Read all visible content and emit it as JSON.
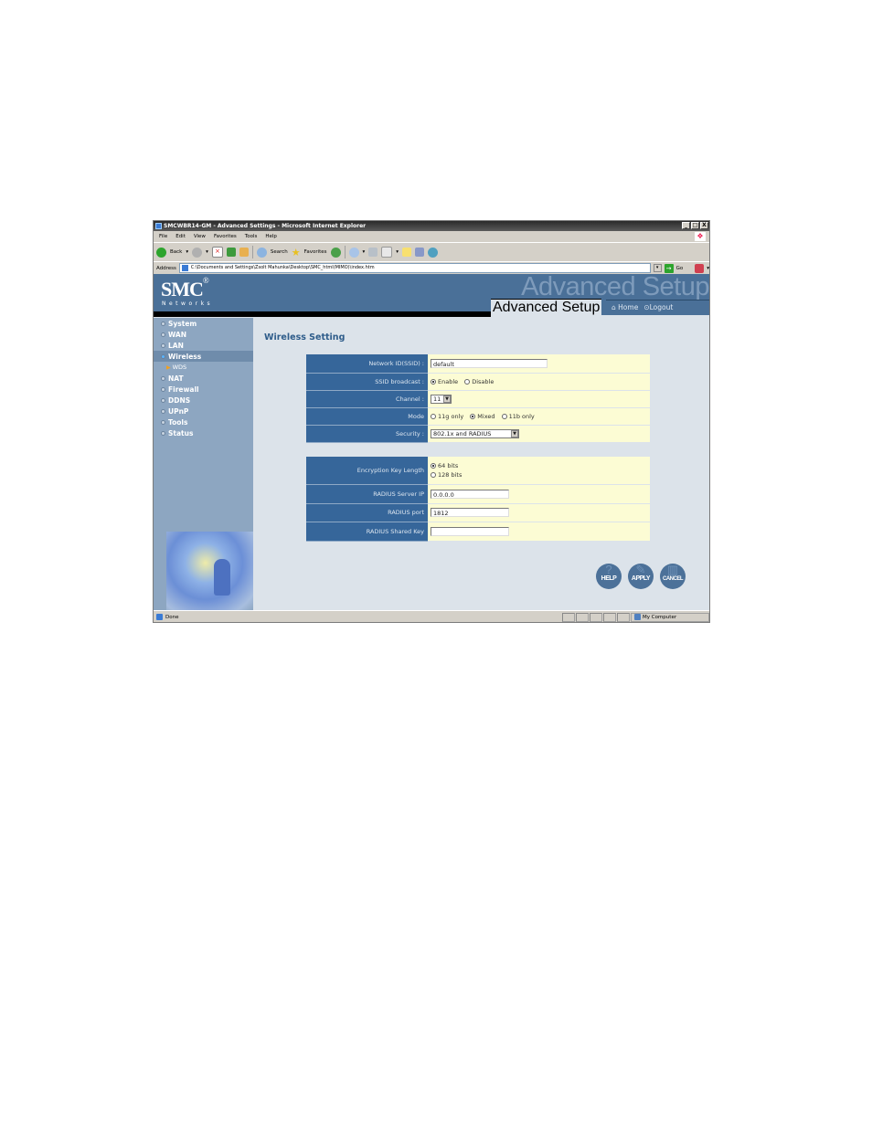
{
  "window": {
    "title": "SMCWBR14-GM - Advanced Settings - Microsoft Internet Explorer",
    "controls": [
      "_",
      "□",
      "X"
    ]
  },
  "menu": [
    "File",
    "Edit",
    "View",
    "Favorites",
    "Tools",
    "Help"
  ],
  "toolbar": {
    "back_label": "Back",
    "search_label": "Search",
    "favorites_label": "Favorites"
  },
  "address": {
    "label": "Address",
    "value": "C:\\Documents and Settings\\Zsolt Mahunka\\Desktop\\SMC_html(MIMO)\\index.htm",
    "go_label": "Go"
  },
  "header": {
    "logo": "SMC",
    "logo_mark": "®",
    "networks": "Networks",
    "banner_watermark": "Advanced Setup",
    "banner_title": "Advanced Setup",
    "home_label": "Home",
    "logout_label": "Logout"
  },
  "sidebar": {
    "items": [
      {
        "label": "System",
        "active": false
      },
      {
        "label": "WAN",
        "active": false
      },
      {
        "label": "LAN",
        "active": false
      },
      {
        "label": "Wireless",
        "active": true
      },
      {
        "label": "NAT",
        "active": false
      },
      {
        "label": "Firewall",
        "active": false
      },
      {
        "label": "DDNS",
        "active": false
      },
      {
        "label": "UPnP",
        "active": false
      },
      {
        "label": "Tools",
        "active": false
      },
      {
        "label": "Status",
        "active": false
      }
    ],
    "subitem": "WDS"
  },
  "main": {
    "title": "Wireless Setting",
    "ssid": {
      "label": "Network ID(SSID) :",
      "value": "default"
    },
    "broadcast": {
      "label": "SSID broadcast :",
      "options": [
        "Enable",
        "Disable"
      ],
      "selected": "Enable"
    },
    "channel": {
      "label": "Channel :",
      "value": "11"
    },
    "mode": {
      "label": "Mode",
      "options": [
        "11g only",
        "Mixed",
        "11b only"
      ],
      "selected": "Mixed"
    },
    "security": {
      "label": "Security :",
      "value": "802.1x and RADIUS"
    },
    "key_length": {
      "label": "Encryption Key Length",
      "options": [
        "64 bits",
        "128 bits"
      ],
      "selected": "64 bits"
    },
    "radius_ip": {
      "label": "RADIUS Server IP",
      "value": "0.0.0.0"
    },
    "radius_port": {
      "label": "RADIUS port",
      "value": "1812"
    },
    "radius_key": {
      "label": "RADIUS Shared Key",
      "value": ""
    }
  },
  "actions": {
    "help": "HELP",
    "apply": "APPLY",
    "cancel": "CANCEL"
  },
  "status": {
    "text": "Done",
    "zone": "My Computer"
  }
}
